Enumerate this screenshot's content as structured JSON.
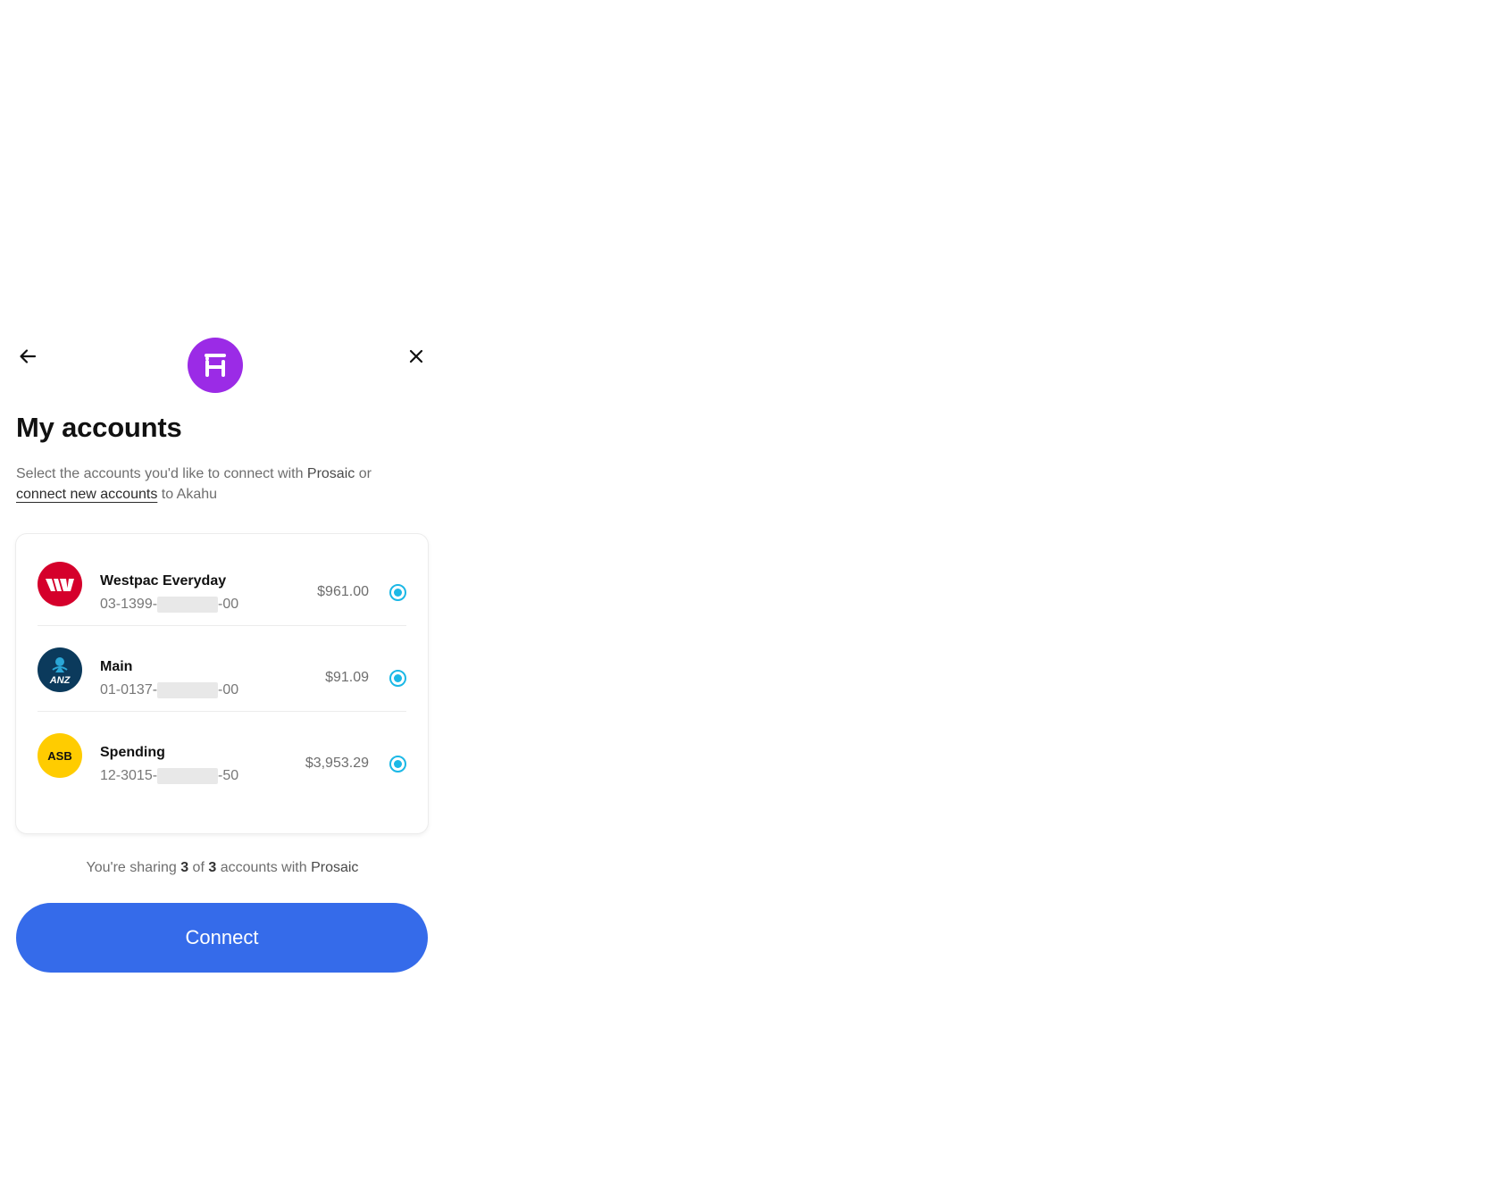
{
  "header": {
    "back_icon": "arrow-left-icon",
    "close_icon": "close-icon",
    "logo_icon": "akahu-logo-icon",
    "logo_color": "#9b2be6"
  },
  "title": "My accounts",
  "subtitle": {
    "part1": "Select the accounts you'd like to connect with ",
    "app_name": "Prosaic",
    "part2": " or ",
    "link_text": "connect new accounts",
    "part3": " to Akahu"
  },
  "accounts": [
    {
      "name": "Westpac Everyday",
      "number_prefix": "03-1399-",
      "number_suffix": "-00",
      "balance": "$961.00",
      "bank": "westpac",
      "logo_color": "#d5002b",
      "selected": true
    },
    {
      "name": "Main",
      "number_prefix": "01-0137-",
      "number_suffix": "-00",
      "balance": "$91.09",
      "bank": "anz",
      "logo_text": "ANZ",
      "logo_color": "#0b3a5c",
      "selected": true
    },
    {
      "name": "Spending",
      "number_prefix": "12-3015-",
      "number_suffix": "-50",
      "balance": "$3,953.29",
      "bank": "asb",
      "logo_text": "ASB",
      "logo_color": "#ffcc00",
      "selected": true
    }
  ],
  "sharing": {
    "prefix": "You're sharing ",
    "count": "3",
    "of": " of ",
    "total": "3",
    "suffix": " accounts with ",
    "app_name": "Prosaic"
  },
  "connect_button": {
    "label": "Connect",
    "color": "#356bea"
  },
  "accent_color": "#1bb8e6"
}
